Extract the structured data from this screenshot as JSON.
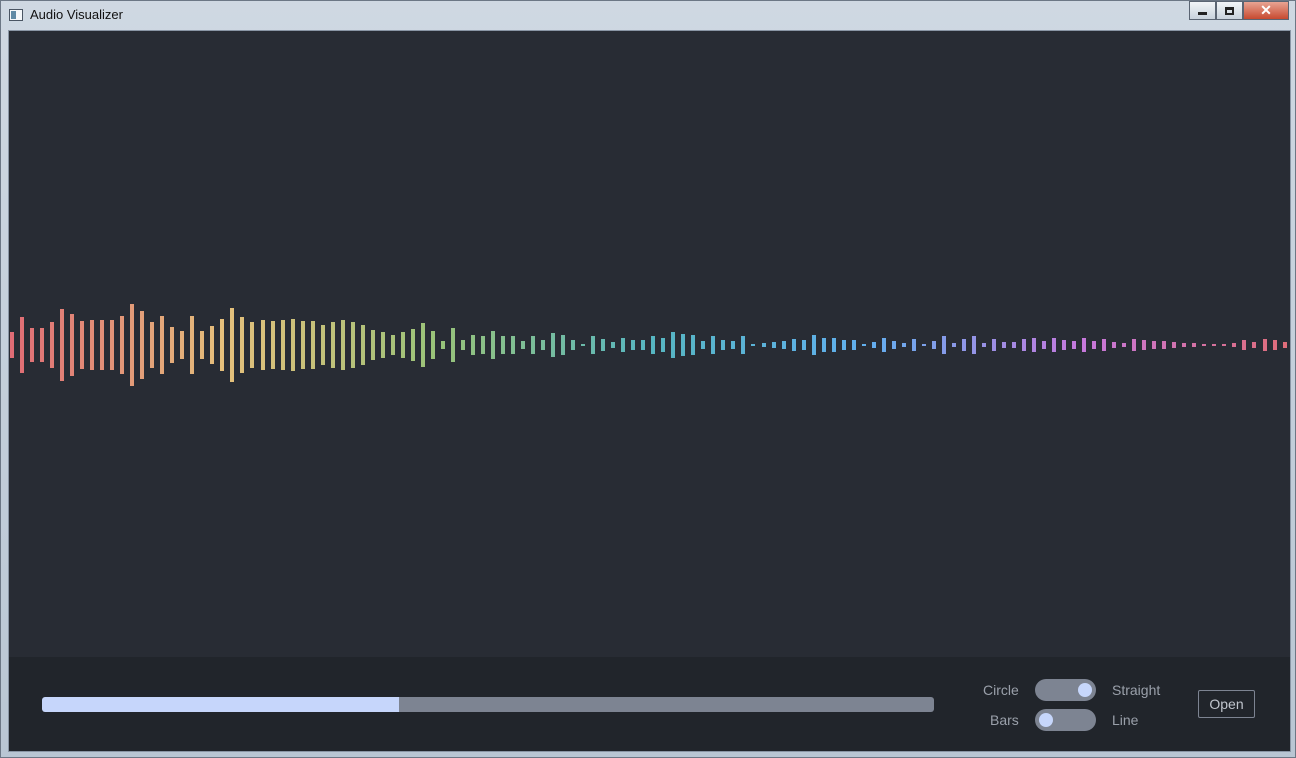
{
  "window": {
    "title": "Audio Visualizer"
  },
  "controls": {
    "progress": 0.4,
    "shape_left_label": "Circle",
    "shape_right_label": "Straight",
    "shape_toggle_on": true,
    "style_left_label": "Bars",
    "style_right_label": "Line",
    "style_toggle_on": false,
    "open_label": "Open"
  },
  "visualizer": {
    "bar_colors": [
      "#e06c75",
      "#e5c07b",
      "#98c379",
      "#56b6c2",
      "#61afef",
      "#c678dd",
      "#e06c75"
    ],
    "amplitudes": [
      0.4,
      0.86,
      0.53,
      0.52,
      0.71,
      1.08,
      0.93,
      0.72,
      0.75,
      0.75,
      0.76,
      0.87,
      1.23,
      1.03,
      0.7,
      0.88,
      0.55,
      0.43,
      0.87,
      0.43,
      0.59,
      0.78,
      1.13,
      0.85,
      0.71,
      0.76,
      0.72,
      0.76,
      0.79,
      0.72,
      0.73,
      0.61,
      0.71,
      0.75,
      0.71,
      0.6,
      0.46,
      0.39,
      0.29,
      0.39,
      0.49,
      0.66,
      0.42,
      0.13,
      0.51,
      0.14,
      0.3,
      0.27,
      0.41,
      0.28,
      0.28,
      0.13,
      0.28,
      0.15,
      0.35,
      0.31,
      0.15,
      0.03,
      0.28,
      0.19,
      0.1,
      0.21,
      0.14,
      0.14,
      0.26,
      0.21,
      0.39,
      0.34,
      0.29,
      0.12,
      0.28,
      0.15,
      0.13,
      0.28,
      0.01,
      0.05,
      0.09,
      0.12,
      0.19,
      0.14,
      0.29,
      0.21,
      0.21,
      0.15,
      0.14,
      0.01,
      0.09,
      0.21,
      0.11,
      0.07,
      0.19,
      0.01,
      0.11,
      0.28,
      0.07,
      0.17,
      0.26,
      0.06,
      0.17,
      0.08,
      0.08,
      0.17,
      0.21,
      0.11,
      0.21,
      0.15,
      0.13,
      0.2,
      0.11,
      0.17,
      0.08,
      0.06,
      0.17,
      0.15,
      0.13,
      0.12,
      0.1,
      0.05,
      0.05,
      0.03,
      0.04,
      0.04,
      0.05,
      0.16,
      0.08,
      0.17,
      0.14,
      0.08,
      0.08
    ]
  }
}
